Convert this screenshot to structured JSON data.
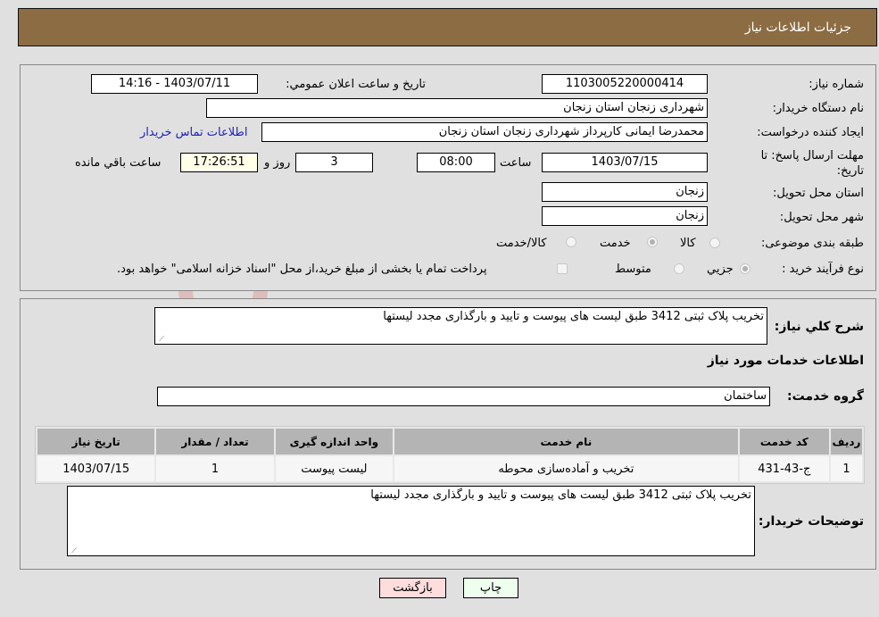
{
  "header": {
    "title": "جزئیات اطلاعات نیاز"
  },
  "form": {
    "need_number": {
      "label": "شماره نیاز:",
      "value": "1103005220000414"
    },
    "announce_datetime": {
      "label": "تاريخ و ساعت اعلان عمومي:",
      "value": "1403/07/11 - 14:16"
    },
    "buyer_org": {
      "label": "نام دستگاه خريدار:",
      "value": "شهرداری زنجان استان زنجان"
    },
    "creator": {
      "label": "ايجاد کننده درخواست:",
      "value": "محمدرضا  ایمانی کارپرداز شهرداری زنجان استان زنجان"
    },
    "buyer_contact_link": "اطلاعات تماس خريدار",
    "deadline": {
      "label": "مهلت ارسال پاسخ: تا تاريخ:",
      "date": "1403/07/15",
      "time_label": "ساعت",
      "time": "08:00",
      "days": "3",
      "days_label": "روز و",
      "remaining": "17:26:51",
      "remaining_label": "ساعت باقي مانده"
    },
    "delivery_province": {
      "label": "استان محل تحویل:",
      "value": "زنجان"
    },
    "delivery_city": {
      "label": "شهر محل تحویل:",
      "value": "زنجان"
    },
    "category": {
      "label": "طبقه بندی موضوعی:",
      "options": [
        "کالا",
        "خدمت",
        "کالا/خدمت"
      ],
      "selected": "خدمت"
    },
    "purchase_type": {
      "label": "نوع فرآیند خرید :",
      "options": [
        "جزيي",
        "متوسط"
      ],
      "selected": "جزيي",
      "treasury_note": "پرداخت تمام یا بخشی از مبلغ خرید،از محل \"اسناد خزانه اسلامی\" خواهد بود."
    }
  },
  "details": {
    "general_desc_label": "شرح کلي نیاز:",
    "general_desc": "تخریب پلاک ثبتی 3412 طبق لیست های پیوست و تایید و بارگذاری مجدد لیستها",
    "services_heading": "اطلاعات خدمات مورد نیاز",
    "service_group_label": "گروه خدمت:",
    "service_group": "ساختمان",
    "table": {
      "headers": [
        "رديف",
        "کد خدمت",
        "نام خدمت",
        "واحد اندازه گيری",
        "تعداد / مقدار",
        "تاريخ نياز"
      ],
      "rows": [
        [
          "1",
          "ج-43-431",
          "تخریب و آماده‌سازی محوطه",
          "لیست پیوست",
          "1",
          "1403/07/15"
        ]
      ]
    },
    "buyer_notes_label": "توضيحات خريدار:",
    "buyer_notes": "تخریب پلاک ثبتی 3412 طبق لیست های پیوست و تایید و بارگذاری مجدد لیستها"
  },
  "buttons": {
    "print": "چاپ",
    "back": "بازگشت"
  },
  "colors": {
    "header_bg": "#8c6c42",
    "print_bg": "#eeffee",
    "back_bg": "#ffdddd"
  }
}
